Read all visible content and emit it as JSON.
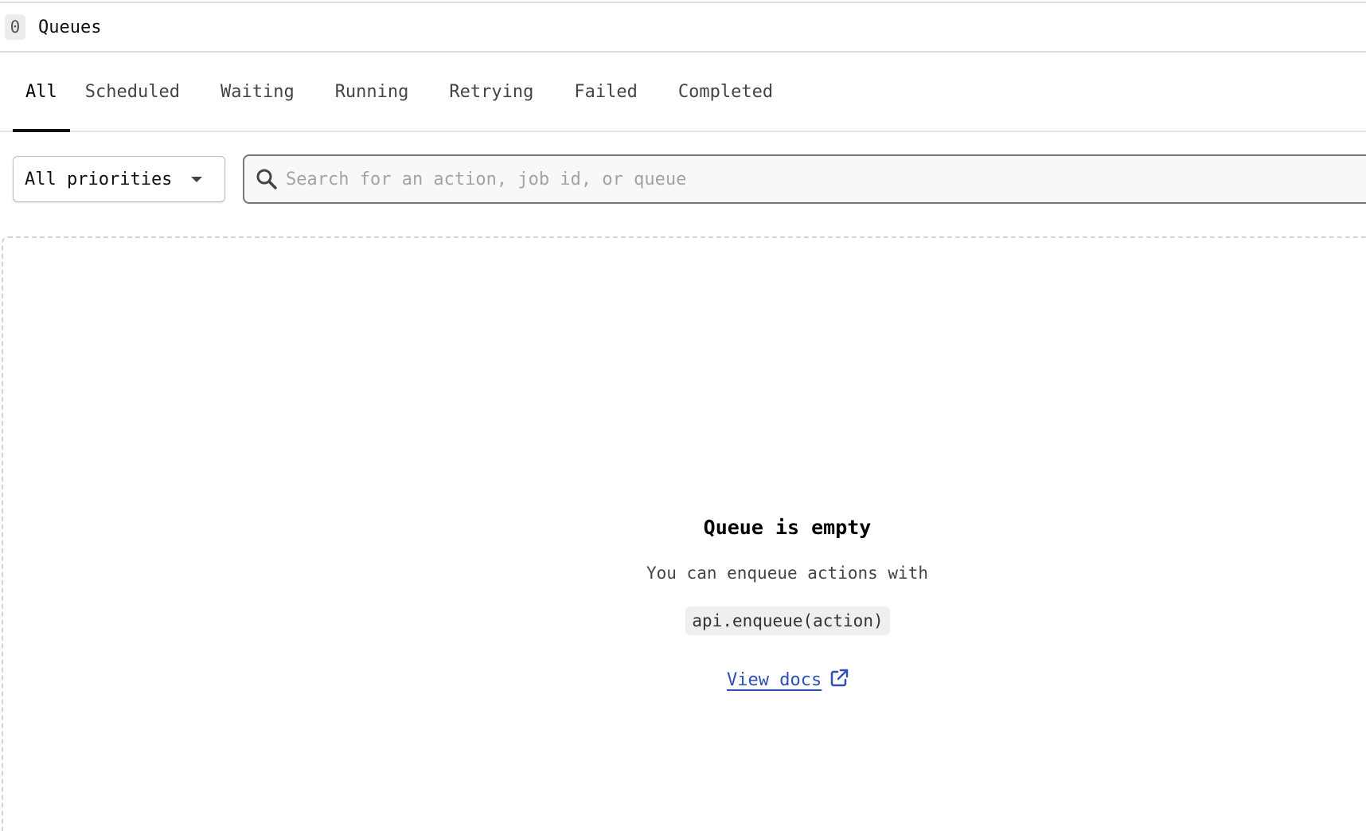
{
  "header": {
    "count": "0",
    "title": "Queues"
  },
  "tabs": [
    {
      "label": "All",
      "active": true
    },
    {
      "label": "Scheduled",
      "active": false
    },
    {
      "label": "Waiting",
      "active": false
    },
    {
      "label": "Running",
      "active": false
    },
    {
      "label": "Retrying",
      "active": false
    },
    {
      "label": "Failed",
      "active": false
    },
    {
      "label": "Completed",
      "active": false
    }
  ],
  "filters": {
    "priority_selected": "All priorities",
    "search_placeholder": "Search for an action, job id, or queue",
    "search_value": ""
  },
  "empty_state": {
    "title": "Queue is empty",
    "text": "You can enqueue actions with",
    "code": "api.enqueue(action)",
    "link_label": "View docs"
  },
  "icons": {
    "search": "search-icon",
    "dropdown": "caret-down-icon",
    "external": "external-link-icon"
  },
  "colors": {
    "link": "#2f4fb8",
    "active_tab_underline": "#111111"
  }
}
